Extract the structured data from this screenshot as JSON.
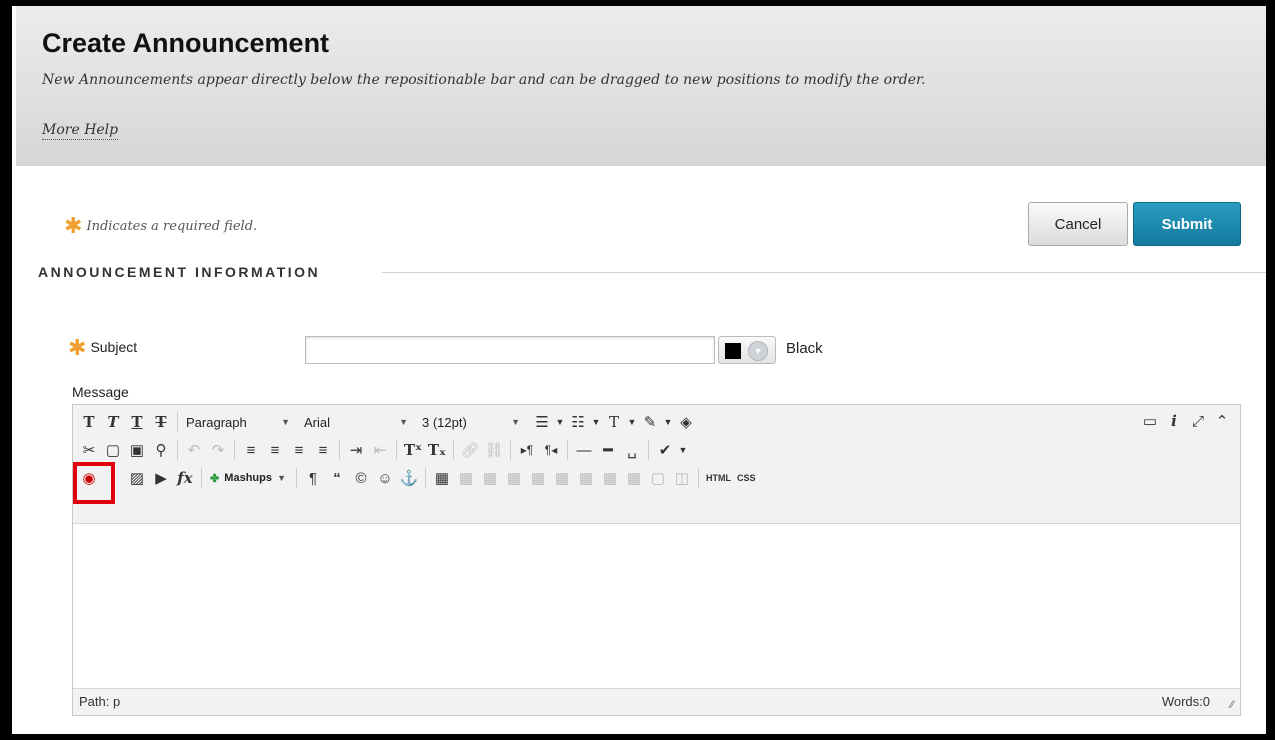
{
  "page": {
    "title": "Create Announcement",
    "subtitle": "New Announcements appear directly below the repositionable bar and can be dragged to new positions to modify the order.",
    "more_help": "More Help"
  },
  "form": {
    "required_note": "Indicates a required field.",
    "cancel_label": "Cancel",
    "submit_label": "Submit",
    "section_title": "ANNOUNCEMENT INFORMATION",
    "subject_label": "Subject",
    "subject_value": "",
    "subject_color": "Black",
    "message_label": "Message"
  },
  "toolbar": {
    "format_select": "Paragraph",
    "font_select": "Arial",
    "size_select": "3 (12pt)",
    "mashups_label": "Mashups",
    "html_label": "HTML",
    "css_label": "CSS"
  },
  "status": {
    "path": "Path: p",
    "words": "Words:0"
  },
  "colors": {
    "submit_bg": "#1a86ad",
    "highlight_border": "#e0000e",
    "required_star": "#f0a030"
  }
}
